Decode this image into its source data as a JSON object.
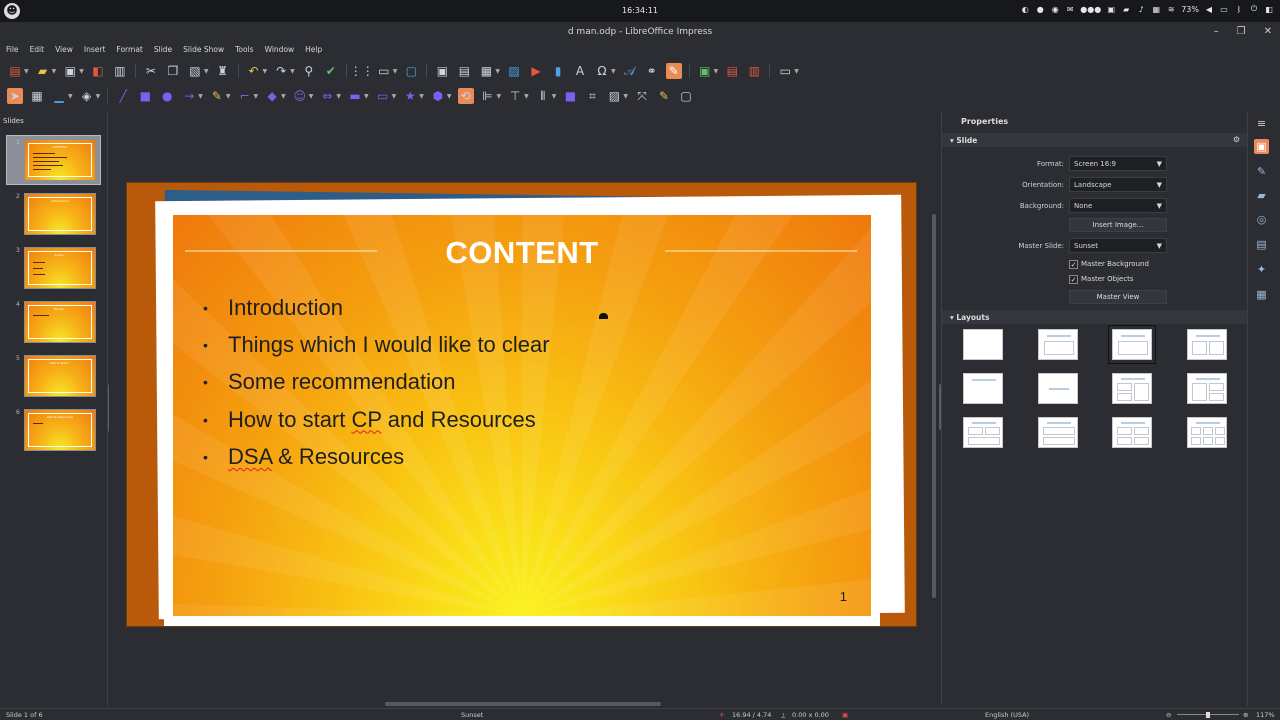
{
  "system_bar": {
    "clock": "16:34:11",
    "battery": "73%",
    "logo_icon": "system-logo-icon"
  },
  "window": {
    "title": "d man.odp - LibreOffice Impress"
  },
  "menu": [
    "File",
    "Edit",
    "View",
    "Insert",
    "Format",
    "Slide",
    "Slide Show",
    "Tools",
    "Window",
    "Help"
  ],
  "slides_pane": {
    "header": "Slides",
    "numbers": [
      "1",
      "2",
      "3",
      "4",
      "5",
      "6"
    ],
    "thumb_titles": [
      "CONTENT",
      "Introduction",
      "Some...",
      "Things...",
      "How to start...",
      "DSA & Resources"
    ]
  },
  "slide": {
    "title": "CONTENT",
    "bullets": [
      "Introduction",
      "Things which I would like to clear",
      "Some recommendation",
      "How to start CP and Resources",
      "DSA & Resources"
    ],
    "page_number": "1",
    "colors": {
      "outer": "#b85a0a",
      "frame_blue": "#2f5d8a",
      "gradient_top": "#ef780c",
      "gradient_bottom": "#fbf21d"
    }
  },
  "properties": {
    "header": "Properties",
    "slide_section": "Slide",
    "format_label": "Format:",
    "format_value": "Screen 16:9",
    "orientation_label": "Orientation:",
    "orientation_value": "Landscape",
    "background_label": "Background:",
    "background_value": "None",
    "insert_image": "Insert Image...",
    "master_slide_label": "Master Slide:",
    "master_slide_value": "Sunset",
    "master_background": "Master Background",
    "master_objects": "Master Objects",
    "master_view": "Master View",
    "layouts_section": "Layouts"
  },
  "status_bar": {
    "slide_info": "Slide 1 of 6",
    "master": "Sunset",
    "position": "16.94 / 4.74",
    "size": "0.00 x 0.00",
    "language": "English (USA)",
    "zoom": "117%"
  },
  "accent_color": "#e98b57"
}
